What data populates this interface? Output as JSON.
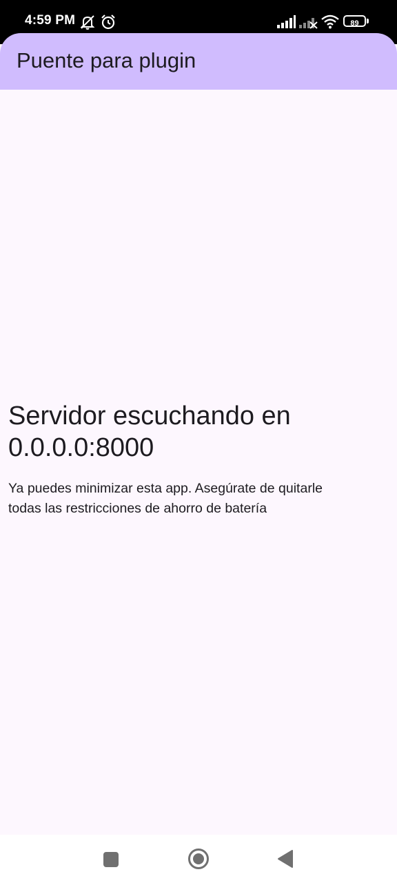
{
  "status_bar": {
    "time": "4:59 PM",
    "battery_level": "89",
    "icons": [
      "notifications-muted-icon",
      "alarm-icon",
      "signal-icon",
      "signal-no-service-icon",
      "wifi-icon",
      "battery-icon"
    ]
  },
  "app_bar": {
    "title": "Puente para plugin",
    "color": "#d0bcfe"
  },
  "main": {
    "headline_line1": "Servidor escuchando en",
    "headline_line2": "0.0.0.0:8000",
    "body_line1": "Ya puedes minimizar esta app. Asegúrate de quitarle",
    "body_line2": "todas las restricciones de ahorro de batería"
  },
  "navigation_bar": {
    "buttons": [
      "recents-button",
      "home-button",
      "back-button"
    ]
  },
  "colors": {
    "background": "#fdf7fe",
    "text": "#1d1b20",
    "nav_icon": "#707070"
  }
}
